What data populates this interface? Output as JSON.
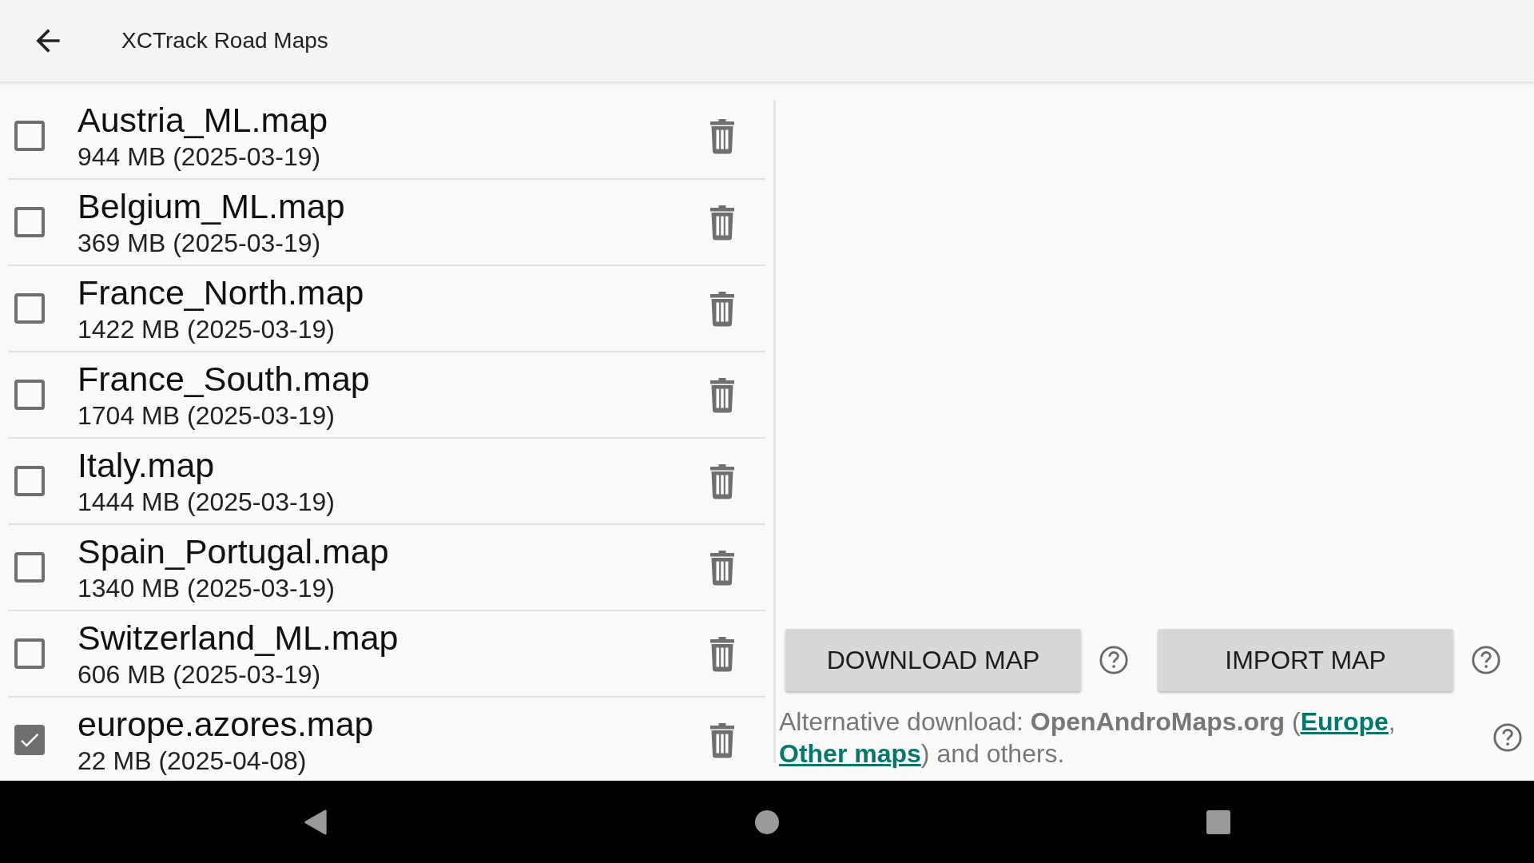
{
  "app_bar": {
    "title": "XCTrack Road Maps"
  },
  "maps": [
    {
      "name": "Austria_ML.map",
      "details": "944 MB (2025-03-19)",
      "checked": false
    },
    {
      "name": "Belgium_ML.map",
      "details": "369 MB (2025-03-19)",
      "checked": false
    },
    {
      "name": "France_North.map",
      "details": "1422 MB (2025-03-19)",
      "checked": false
    },
    {
      "name": "France_South.map",
      "details": "1704 MB (2025-03-19)",
      "checked": false
    },
    {
      "name": "Italy.map",
      "details": "1444 MB (2025-03-19)",
      "checked": false
    },
    {
      "name": "Spain_Portugal.map",
      "details": "1340 MB (2025-03-19)",
      "checked": false
    },
    {
      "name": "Switzerland_ML.map",
      "details": "606 MB (2025-03-19)",
      "checked": false
    },
    {
      "name": "europe.azores.map",
      "details": "22 MB (2025-04-08)",
      "checked": true
    }
  ],
  "buttons": [
    {
      "label": "DOWNLOAD MAP"
    },
    {
      "label": "IMPORT MAP"
    }
  ],
  "note": {
    "before": "Alternative download: **OpenAndroMaps.org** (",
    "links": [
      {
        "label": "Europe"
      },
      {
        "label": "Other maps"
      }
    ],
    "between": ", ",
    "after": ") and others."
  }
}
